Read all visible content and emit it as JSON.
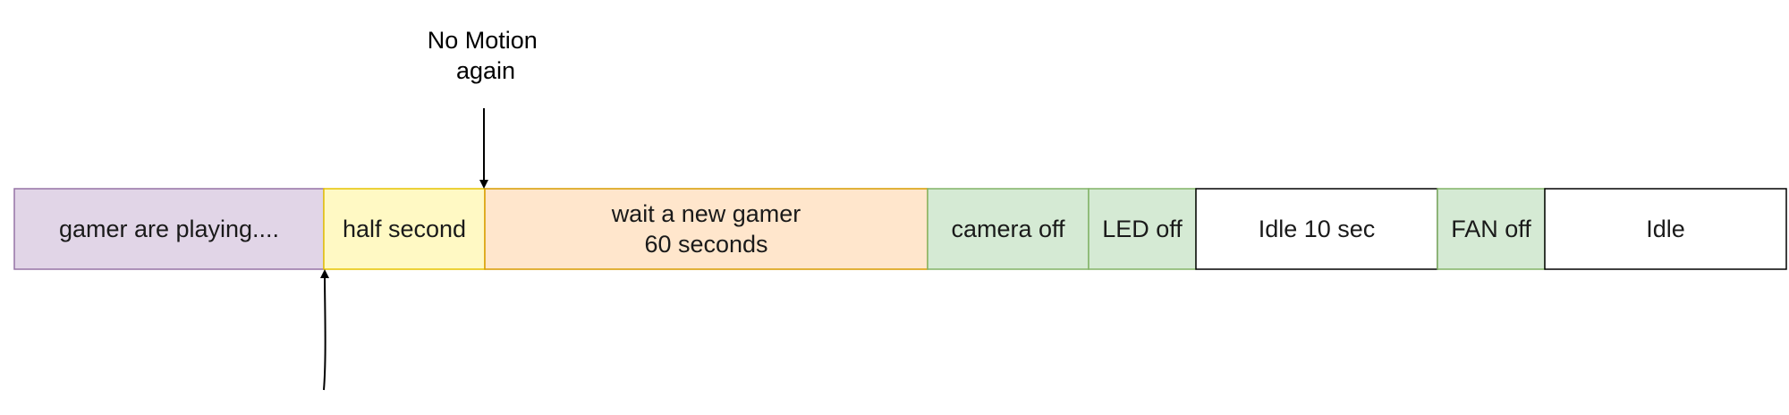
{
  "timeline": {
    "blocks": [
      {
        "id": "gamer-playing",
        "lines": [
          "gamer are playing...."
        ],
        "fill": "#e1d5e7",
        "stroke": "#9673a6"
      },
      {
        "id": "half-second",
        "lines": [
          "half second"
        ],
        "fill": "#fff9c4",
        "stroke": "#e6c300"
      },
      {
        "id": "wait-new-gamer",
        "lines": [
          "wait a new gamer",
          "60 seconds"
        ],
        "fill": "#ffe6cc",
        "stroke": "#d79b00"
      },
      {
        "id": "camera-off",
        "lines": [
          "camera off"
        ],
        "fill": "#d5ead4",
        "stroke": "#82b366"
      },
      {
        "id": "led-off",
        "lines": [
          "LED off"
        ],
        "fill": "#d5ead4",
        "stroke": "#82b366"
      },
      {
        "id": "idle-10-sec",
        "lines": [
          "Idle 10 sec"
        ],
        "fill": "#ffffff",
        "stroke": "#000000"
      },
      {
        "id": "fan-off",
        "lines": [
          "FAN off"
        ],
        "fill": "#d5ead4",
        "stroke": "#82b366"
      },
      {
        "id": "idle",
        "lines": [
          "Idle"
        ],
        "fill": "#ffffff",
        "stroke": "#000000"
      }
    ]
  },
  "annotations": {
    "no_motion_again": [
      "No Motion",
      "again"
    ]
  },
  "colors": {
    "arrow": "#000000"
  }
}
